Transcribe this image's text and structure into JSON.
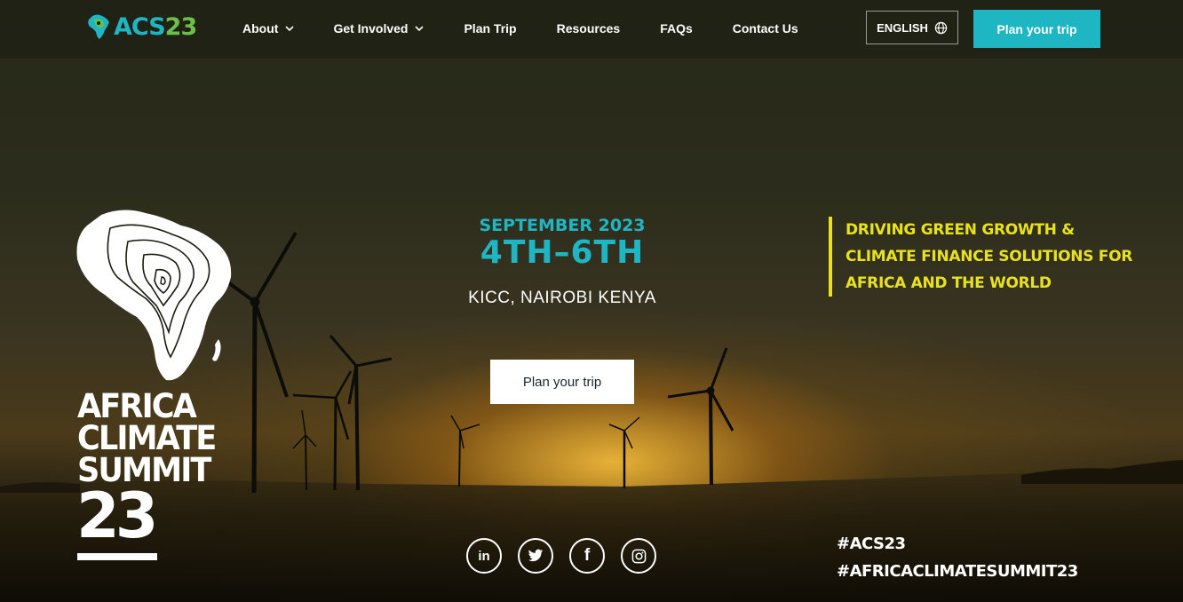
{
  "header": {
    "logo": {
      "text_main": "ACS",
      "text_num": "23",
      "icon": "africa-map-icon"
    },
    "nav": [
      {
        "label": "About",
        "has_dropdown": true
      },
      {
        "label": "Get Involved",
        "has_dropdown": true
      },
      {
        "label": "Plan Trip",
        "has_dropdown": false
      },
      {
        "label": "Resources",
        "has_dropdown": false
      },
      {
        "label": "FAQs",
        "has_dropdown": false
      },
      {
        "label": "Contact Us",
        "has_dropdown": false
      }
    ],
    "language": {
      "label": "ENGLISH",
      "icon": "globe-icon"
    },
    "cta_label": "Plan your trip"
  },
  "hero": {
    "brand": {
      "title_lines": [
        "AFRICA",
        "CLIMATE",
        "SUMMIT"
      ],
      "number": "23",
      "icon": "africa-contour-icon"
    },
    "date_month": "SEPTEMBER 2023",
    "date_days": "4TH–6TH",
    "venue": "KICC, NAIROBI KENYA",
    "cta_label": "Plan your trip",
    "tagline": [
      "DRIVING GREEN GROWTH &",
      "CLIMATE FINANCE SOLUTIONS FOR",
      "AFRICA AND THE WORLD"
    ],
    "socials": [
      {
        "name": "linkedin-icon",
        "glyph": "in"
      },
      {
        "name": "twitter-icon",
        "glyph": ""
      },
      {
        "name": "facebook-icon",
        "glyph": "f"
      },
      {
        "name": "instagram-icon",
        "glyph": ""
      }
    ],
    "hashtags": [
      "#ACS23",
      "#AFRICACLIMATESUMMIT23"
    ]
  },
  "colors": {
    "accent_teal": "#1fb6c4",
    "accent_green": "#6cc04a",
    "tagline_yellow": "#e8e21e",
    "text_white": "#ffffff"
  }
}
